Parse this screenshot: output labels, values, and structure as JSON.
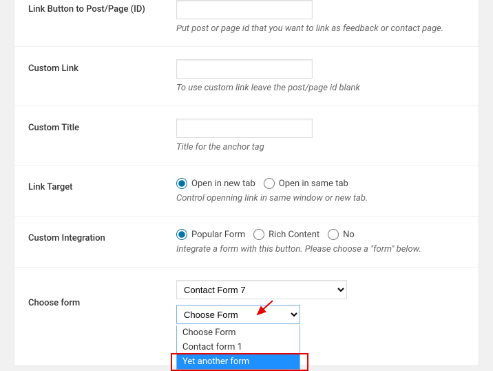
{
  "rows": {
    "link_button_id": {
      "label": "Link Button to Post/Page (ID)",
      "value": "",
      "description": "Put post or page id that you want to link as feedback or contact page."
    },
    "custom_link": {
      "label": "Custom Link",
      "value": "",
      "description": "To use custom link leave the post/page id blank"
    },
    "custom_title": {
      "label": "Custom Title",
      "value": "",
      "description": "Title for the anchor tag"
    },
    "link_target": {
      "label": "Link Target",
      "options": {
        "new_tab": "Open in new tab",
        "same_tab": "Open in same tab"
      },
      "description": "Control openning link in same window or new tab."
    },
    "custom_integration": {
      "label": "Custom Integration",
      "options": {
        "popular_form": "Popular Form",
        "rich_content": "Rich Content",
        "no": "No"
      },
      "description": "Integrate a form with this button. Please choose a \"form\" below."
    },
    "choose_form": {
      "label": "Choose form",
      "select1_value": "Contact Form 7",
      "select2_value": "Choose Form",
      "dropdown_items": [
        "Choose Form",
        "Contact form 1",
        "Yet another form"
      ]
    }
  }
}
